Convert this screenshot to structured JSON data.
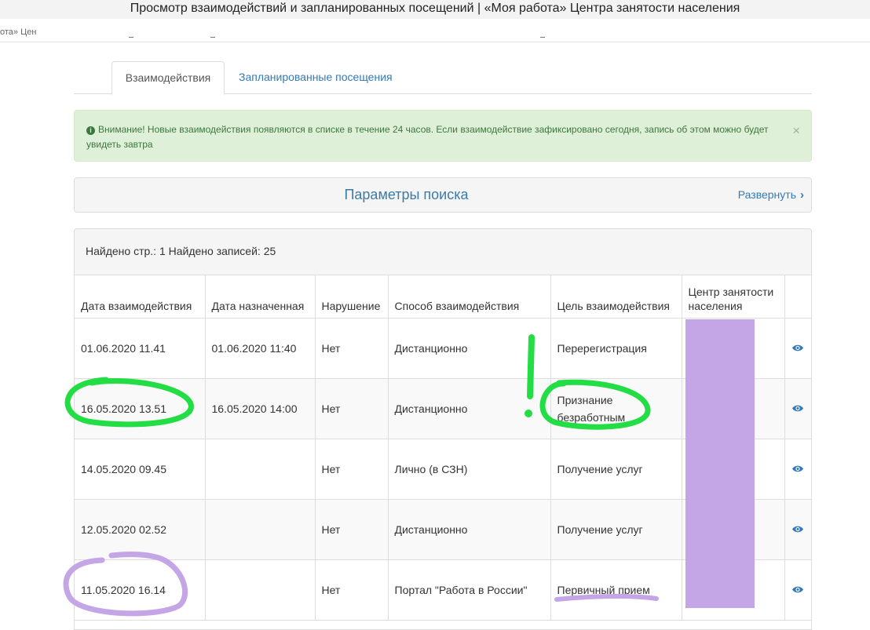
{
  "window": {
    "title": "Просмотр взаимодействий и запланированных посещений | «Моя работа» Центра занятости населения",
    "tab_fragment": "ота» Цен"
  },
  "tabs": [
    {
      "label": "Взаимодействия",
      "active": true
    },
    {
      "label": "Запланированные посещения",
      "active": false
    }
  ],
  "alert": {
    "icon": "info-icon",
    "text": "Внимание! Новые взаимодействия появляются в списке в течение 24 часов. Если взаимодействие зафиксировано сегодня, запись об этом можно будет увидеть завтра",
    "close": "×"
  },
  "search": {
    "title": "Параметры поиска",
    "expand_label": "Развернуть",
    "expand_icon": "›"
  },
  "results": {
    "summary": "Найдено стр.: 1 Найдено записей: 25",
    "columns": [
      "Дата взаимодействия",
      "Дата назначенная",
      "Нарушение",
      "Способ взаимодействия",
      "Цель взаимодействия",
      "Центр занятости населения",
      ""
    ],
    "rows": [
      [
        "01.06.2020 11.41",
        "01.06.2020 11:40",
        "Нет",
        "Дистанционно",
        "Перерегистрация"
      ],
      [
        "16.05.2020 13.51",
        "16.05.2020 14:00",
        "Нет",
        "Дистанционно",
        "Признание безработным"
      ],
      [
        "14.05.2020 09.45",
        "",
        "Нет",
        "Лично (в СЗН)",
        "Получение услуг"
      ],
      [
        "12.05.2020 02.52",
        "",
        "Нет",
        "Дистанционно",
        "Получение услуг"
      ],
      [
        "11.05.2020 16.14",
        "",
        "Нет",
        "Портал \"Работа в России\"",
        "Первичный прием"
      ]
    ]
  },
  "annotations": {
    "exclamation": "!",
    "green": "#22dd44",
    "purple": "#c4a5e6"
  }
}
